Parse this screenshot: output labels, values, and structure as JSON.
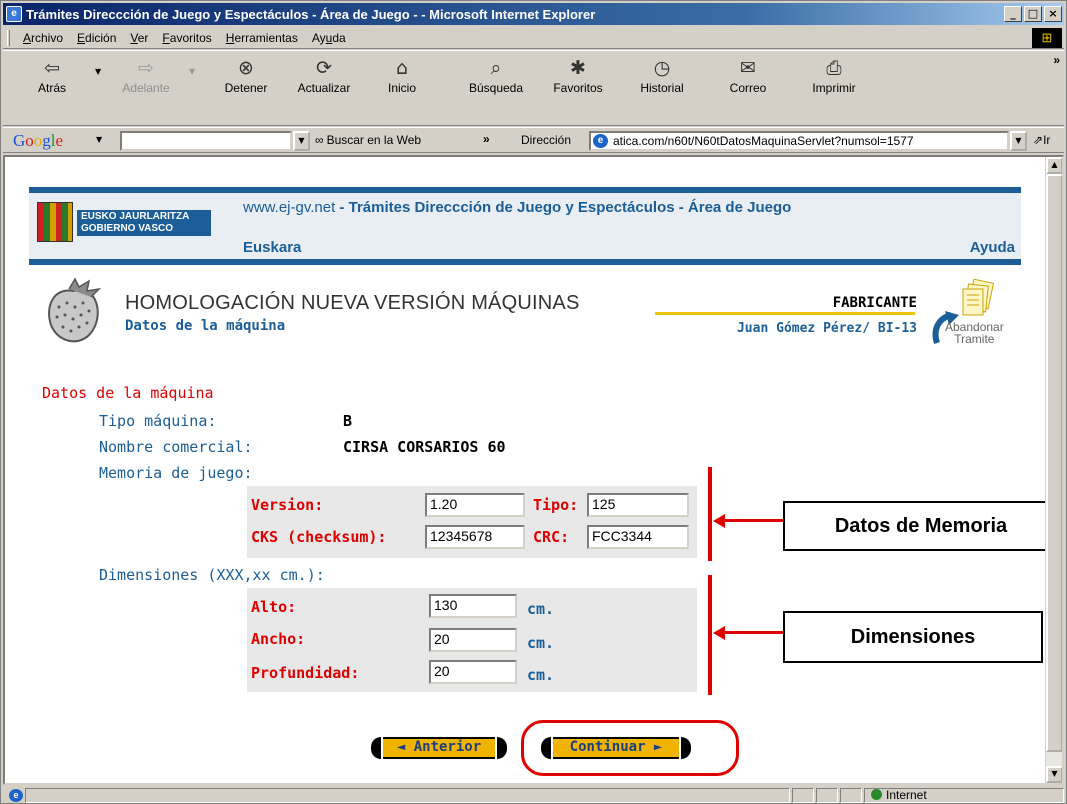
{
  "window": {
    "title": "Trámites Direccción de Juego y Espectáculos - Área de Juego - - Microsoft Internet Explorer"
  },
  "menu": [
    {
      "pre": "",
      "u": "A",
      "post": "rchivo"
    },
    {
      "pre": "",
      "u": "E",
      "post": "dición"
    },
    {
      "pre": "",
      "u": "V",
      "post": "er"
    },
    {
      "pre": "",
      "u": "F",
      "post": "avoritos"
    },
    {
      "pre": "",
      "u": "H",
      "post": "erramientas"
    },
    {
      "pre": "Ay",
      "u": "u",
      "post": "da"
    }
  ],
  "toolbar": {
    "back": "Atrás",
    "forward": "Adelante",
    "stop": "Detener",
    "refresh": "Actualizar",
    "home": "Inicio",
    "search": "Búsqueda",
    "favorites": "Favoritos",
    "history": "Historial",
    "mail": "Correo",
    "print": "Imprimir"
  },
  "google_bar": {
    "search_web": "Buscar en la Web",
    "query": ""
  },
  "address": {
    "label": "Dirección",
    "url": "atica.com/n60t/N60tDatosMaquinaServlet?numsol=1577",
    "go": "Ir"
  },
  "banner": {
    "logo_line1": "EUSKO JAURLARITZA",
    "logo_line2": "GOBIERNO VASCO",
    "site": "www.ej-gv.net",
    "separator": " - ",
    "title": "Trámites Direccción de Juego y Espectáculos - Área de Juego",
    "language_link": "Euskara",
    "help_link": "Ayuda"
  },
  "heading": {
    "main": "HOMOLOGACIÓN NUEVA VERSIÓN MÁQUINAS",
    "sub": "Datos de la máquina",
    "role": "FABRICANTE",
    "user": "Juan Gómez Pérez/ BI-13",
    "abandon_line1": "Abandonar",
    "abandon_line2": "Tramite"
  },
  "form": {
    "section": "Datos de la máquina",
    "tipo_label": "Tipo máquina:",
    "tipo_value": "B",
    "nombre_label": "Nombre comercial:",
    "nombre_value": "CIRSA CORSARIOS 60",
    "memoria_label": "Memoria de juego:",
    "version_label": "Version:",
    "version_value": "1.20",
    "tipo_mem_label": "Tipo:",
    "tipo_mem_value": "125",
    "cks_label": "CKS (checksum):",
    "cks_value": "12345678",
    "crc_label": "CRC:",
    "crc_value": "FCC3344",
    "dimensiones_label": "Dimensiones (XXX,xx cm.):",
    "alto_label": "Alto:",
    "alto_value": "130",
    "ancho_label": "Ancho:",
    "ancho_value": "20",
    "prof_label": "Profundidad:",
    "prof_value": "20",
    "unit": "cm."
  },
  "annotations": {
    "memoria": "Datos de Memoria",
    "dimensiones": "Dimensiones"
  },
  "buttons": {
    "back": "◄ Anterior",
    "continue": "Continuar ►"
  },
  "status": {
    "zone": "Internet"
  },
  "colors": {
    "brand_blue": "#1b5e98",
    "accent_red": "#e00000",
    "button_yellow": "#f0b400"
  }
}
